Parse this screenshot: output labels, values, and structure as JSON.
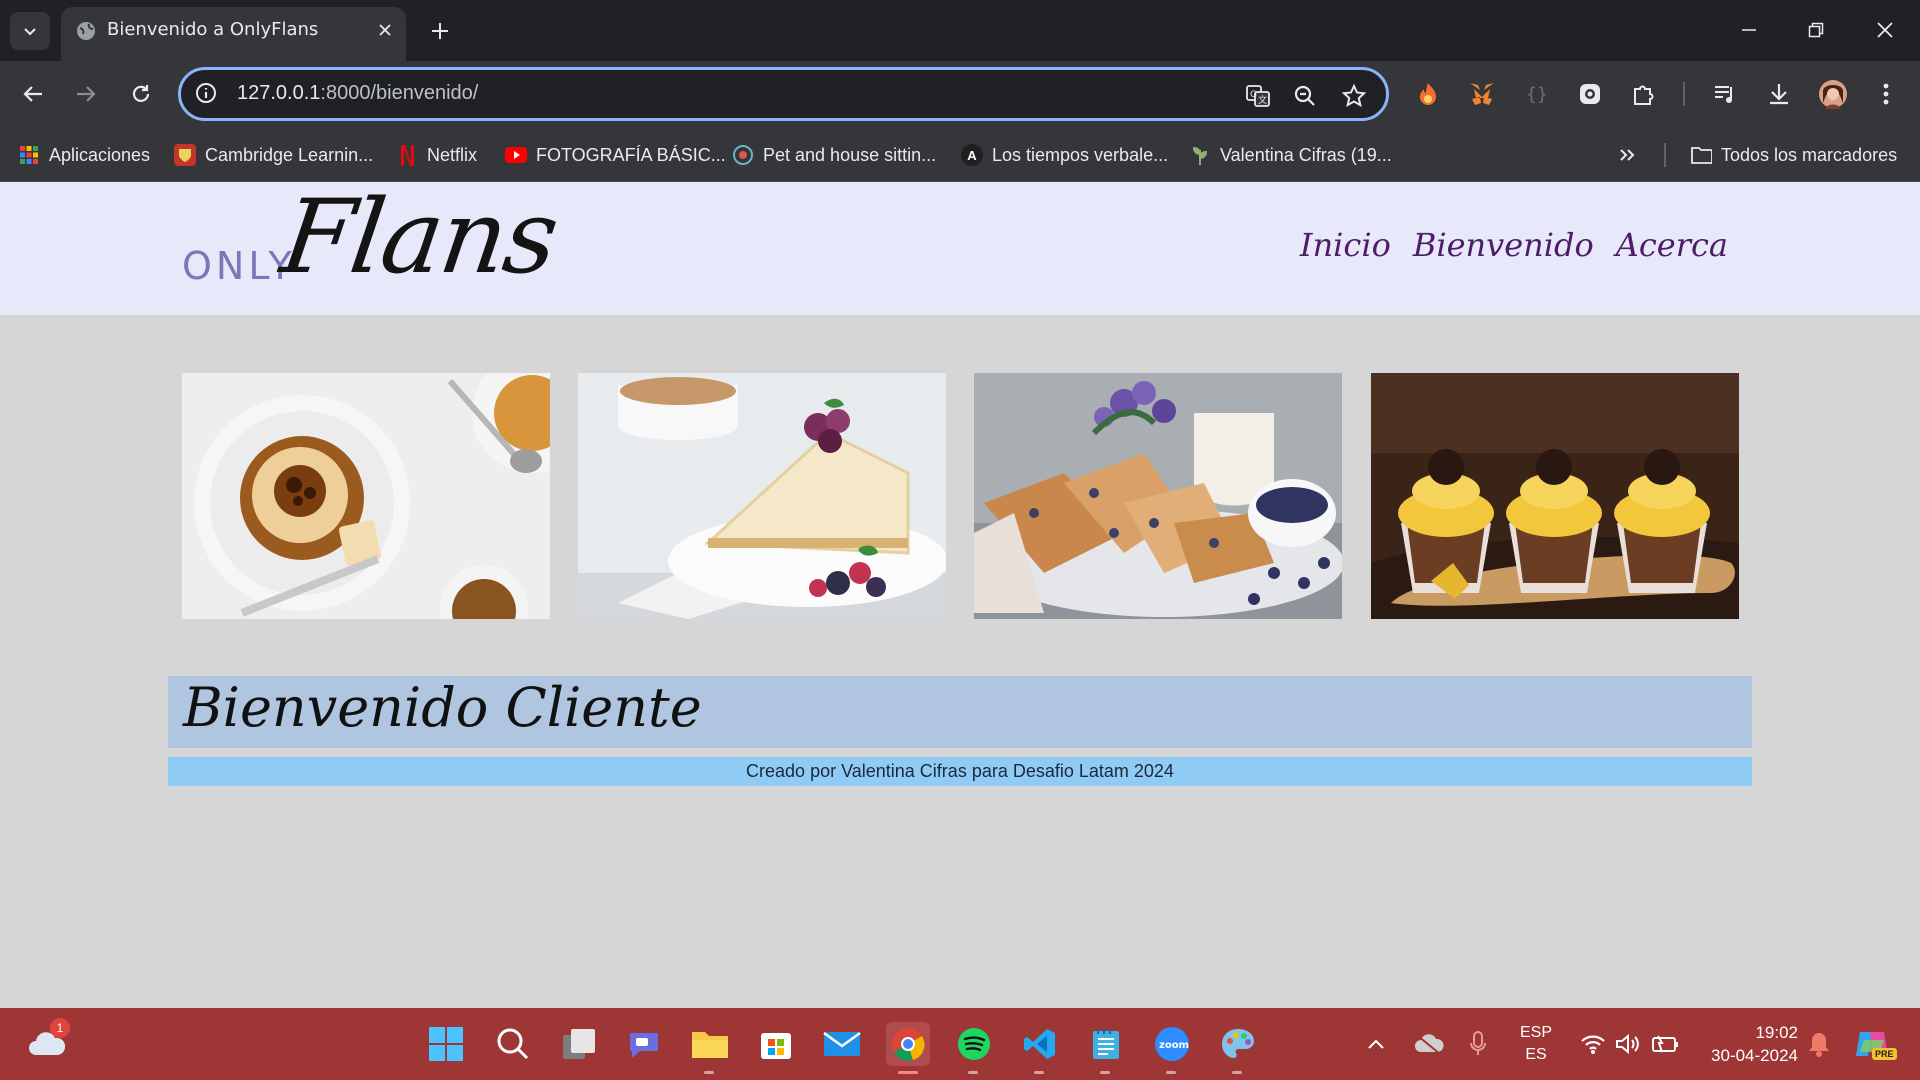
{
  "browser": {
    "tab_title": "Bienvenido a OnlyFlans",
    "url_host": "127.0.0.1",
    "url_path": ":8000/bienvenido/",
    "bookmarks": [
      {
        "label": "Aplicaciones",
        "icon": "apps-grid-icon"
      },
      {
        "label": "Cambridge Learnin...",
        "icon": "cambridge-icon"
      },
      {
        "label": "Netflix",
        "icon": "netflix-icon"
      },
      {
        "label": "FOTOGRAFÍA BÁSIC...",
        "icon": "youtube-icon"
      },
      {
        "label": "Pet and house sittin...",
        "icon": "globe-icon"
      },
      {
        "label": "Los tiempos verbale...",
        "icon": "a-letter-icon"
      },
      {
        "label": "Valentina Cifras (19...",
        "icon": "plant-icon"
      }
    ],
    "all_bookmarks_label": "Todos los marcadores"
  },
  "site": {
    "logo_only": "ONLY",
    "logo_flans": "Flans",
    "nav": [
      "Inicio",
      "Bienvenido",
      "Acerca"
    ],
    "welcome_heading": "Bienvenido Cliente",
    "footer_text": "Creado por Valentina Cifras para Desafio Latam 2024"
  },
  "taskbar": {
    "weather_badge": "1",
    "lang_top": "ESP",
    "lang_bottom": "ES",
    "time": "19:02",
    "date": "30-04-2024",
    "copilot_badge": "PRE"
  },
  "colors": {
    "header_bg": "#e8e8fb",
    "page_bg": "#d6d6d6",
    "nav_color": "#4b1e66",
    "welcome_bg": "#afc5e0",
    "footer_bg": "#8fcbf4",
    "taskbar_bg": "#9e3636"
  }
}
